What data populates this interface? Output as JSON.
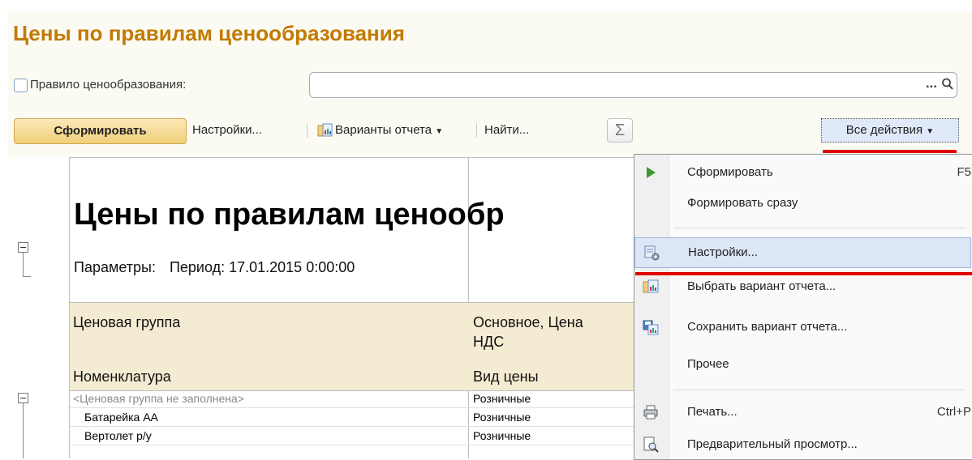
{
  "title": "Цены по правилам ценообразования",
  "rule": {
    "label": "Правило ценообразования:",
    "value": "",
    "dots": "..."
  },
  "toolbar": {
    "generate": "Сформировать",
    "settings": "Настройки...",
    "variants": "Варианты отчета",
    "find": "Найти...",
    "sigma": "Σ",
    "all_actions": "Все действия"
  },
  "report": {
    "heading": "Цены по правилам ценообр",
    "params_label": "Параметры:",
    "params_value": "Период: 17.01.2015 0:00:00",
    "col1_group": "Ценовая группа",
    "col2_group_line1": "Основное, Цена",
    "col2_group_line2": "НДС",
    "col1_item": "Номенклатура",
    "col2_item": "Вид цены",
    "rows": [
      {
        "name": "<Ценовая группа не заполнена>",
        "price_type": "Розничные"
      },
      {
        "name": "Батарейка АА",
        "price_type": "Розничные"
      },
      {
        "name": "Вертолет р/у",
        "price_type": "Розничные"
      }
    ]
  },
  "menu": {
    "items": [
      {
        "label": "Сформировать",
        "shortcut": "F5",
        "icon": "play-icon"
      },
      {
        "label": "Формировать сразу",
        "shortcut": "",
        "icon": ""
      },
      {
        "label": "Настройки...",
        "shortcut": "",
        "icon": "settings-icon"
      },
      {
        "label": "Выбрать вариант отчета...",
        "shortcut": "",
        "icon": "report-variant-icon"
      },
      {
        "label": "Сохранить вариант отчета...",
        "shortcut": "",
        "icon": "save-variant-icon"
      },
      {
        "label": "Прочее",
        "shortcut": "",
        "icon": ""
      },
      {
        "label": "Печать...",
        "shortcut": "Ctrl+P",
        "icon": "printer-icon"
      },
      {
        "label": "Предварительный просмотр...",
        "shortcut": "",
        "icon": "preview-icon"
      }
    ]
  },
  "colors": {
    "title": "#c27a00",
    "highlight": "#dbe6f7",
    "underline": "#e00000",
    "header_bg": "#f4ecd2"
  }
}
